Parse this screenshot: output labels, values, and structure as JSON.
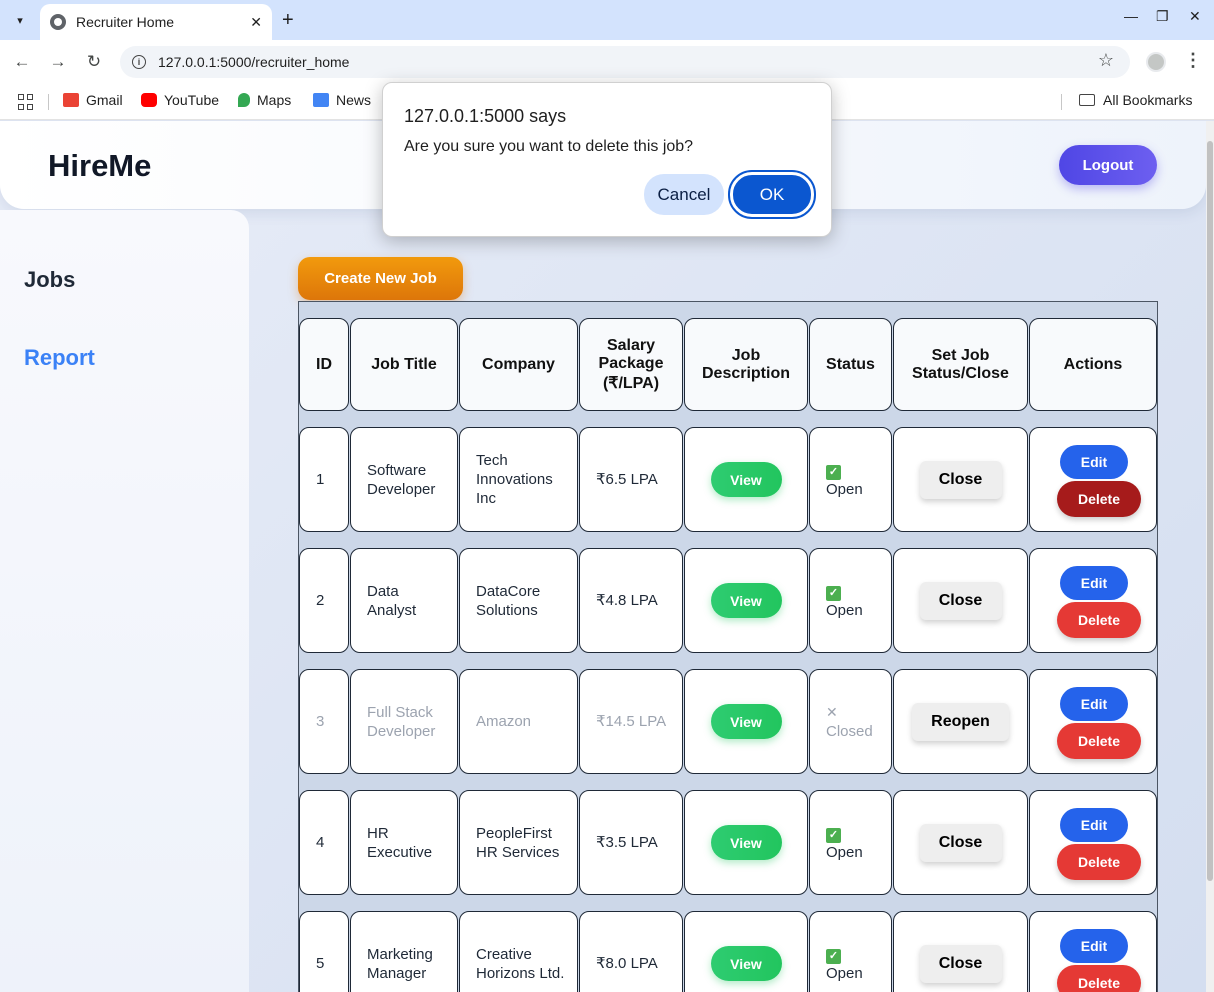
{
  "browser": {
    "tab_title": "Recruiter Home",
    "new_tab": "+",
    "url": "127.0.0.1:5000/recruiter_home",
    "bookmarks": [
      {
        "label": "Gmail",
        "icon": "gmail-icon",
        "color": "#ea4335"
      },
      {
        "label": "YouTube",
        "icon": "youtube-icon",
        "color": "#ff0000"
      },
      {
        "label": "Maps",
        "icon": "maps-icon",
        "color": "#34a853"
      },
      {
        "label": "News",
        "icon": "news-icon",
        "color": "#4285f4"
      }
    ],
    "all_bookmarks": "All Bookmarks"
  },
  "header": {
    "brand": "HireMe",
    "logout": "Logout"
  },
  "sidebar": {
    "jobs": "Jobs",
    "report": "Report",
    "accent": "#3b82f6"
  },
  "main": {
    "create_button": "Create New Job",
    "columns": [
      "ID",
      "Job Title",
      "Company",
      "Salary Package (₹/LPA)",
      "Job Description",
      "Status",
      "Set Job Status/Close",
      "Actions"
    ],
    "view_label": "View",
    "edit_label": "Edit",
    "delete_label": "Delete",
    "rows": [
      {
        "id": "1",
        "title": "Software Developer",
        "company": "Tech Innovations Inc",
        "salary": "₹6.5 LPA",
        "status": "Open",
        "toggle": "Close",
        "closed": false
      },
      {
        "id": "2",
        "title": "Data Analyst",
        "company": "DataCore Solutions",
        "salary": "₹4.8 LPA",
        "status": "Open",
        "toggle": "Close",
        "closed": false
      },
      {
        "id": "3",
        "title": "Full Stack Developer",
        "company": "Amazon",
        "salary": "₹14.5 LPA",
        "status": "Closed",
        "toggle": "Reopen",
        "closed": true
      },
      {
        "id": "4",
        "title": "HR Executive",
        "company": "PeopleFirst HR Services",
        "salary": "₹3.5 LPA",
        "status": "Open",
        "toggle": "Close",
        "closed": false
      },
      {
        "id": "5",
        "title": "Marketing Manager",
        "company": "Creative Horizons Ltd.",
        "salary": "₹8.0 LPA",
        "status": "Open",
        "toggle": "Close",
        "closed": false
      }
    ]
  },
  "dialog": {
    "title": "127.0.0.1:5000 says",
    "message": "Are you sure you want to delete this job?",
    "cancel": "Cancel",
    "ok": "OK"
  }
}
